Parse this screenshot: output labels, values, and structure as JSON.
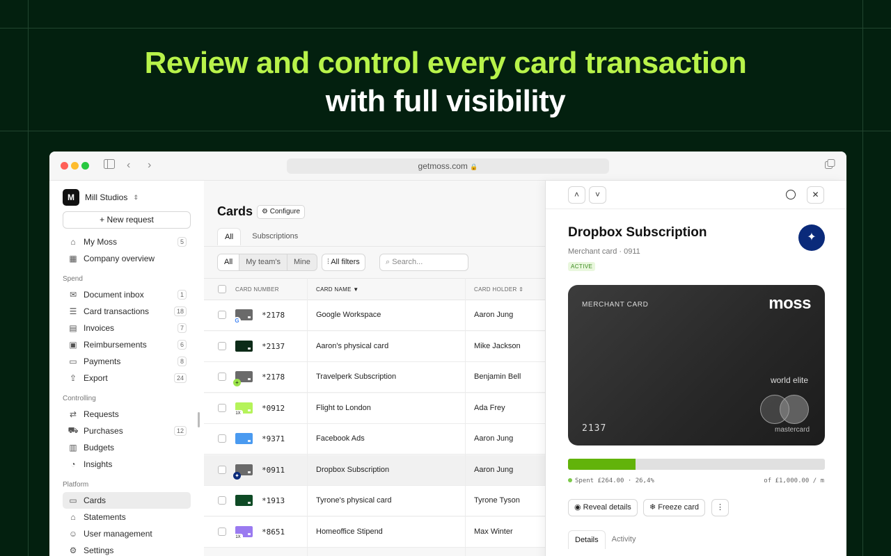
{
  "hero": {
    "line1": "Review and control every card transaction",
    "line2": "with full visibility"
  },
  "browser": {
    "url": "getmoss.com",
    "colors": {
      "close": "#ff5f57",
      "minimize": "#febc2e",
      "zoom": "#28c840"
    }
  },
  "sidebar": {
    "org_name": "Mill Studios",
    "new_request": "New request",
    "top_items": [
      {
        "label": "My Moss",
        "count": "5",
        "icon": "home-icon"
      },
      {
        "label": "Company overview",
        "count": "",
        "icon": "building-icon"
      }
    ],
    "sections": {
      "spend": "Spend",
      "controlling": "Controlling",
      "platform": "Platform"
    },
    "spend_items": [
      {
        "label": "Document inbox",
        "count": "1",
        "icon": "inbox-icon"
      },
      {
        "label": "Card transactions",
        "count": "18",
        "icon": "card-transactions-icon"
      },
      {
        "label": "Invoices",
        "count": "7",
        "icon": "invoice-icon"
      },
      {
        "label": "Reimbursements",
        "count": "6",
        "icon": "wallet-icon"
      },
      {
        "label": "Payments",
        "count": "8",
        "icon": "payments-icon"
      },
      {
        "label": "Export",
        "count": "24",
        "icon": "export-icon"
      }
    ],
    "controlling_items": [
      {
        "label": "Requests",
        "count": "",
        "icon": "requests-icon"
      },
      {
        "label": "Purchases",
        "count": "12",
        "icon": "cart-icon"
      },
      {
        "label": "Budgets",
        "count": "",
        "icon": "budgets-icon"
      },
      {
        "label": "Insights",
        "count": "",
        "icon": "pie-chart-icon"
      }
    ],
    "platform_items": [
      {
        "label": "Cards",
        "count": "",
        "icon": "cards-icon"
      },
      {
        "label": "Statements",
        "count": "",
        "icon": "bank-icon"
      },
      {
        "label": "User management",
        "count": "",
        "icon": "users-icon"
      },
      {
        "label": "Settings",
        "count": "",
        "icon": "gear-icon"
      }
    ]
  },
  "main": {
    "title": "Cards",
    "configure": "Configure",
    "tabs": [
      "All",
      "Subscriptions"
    ],
    "segments": [
      "All",
      "My team's",
      "Mine"
    ],
    "all_filters": "All filters",
    "search_placeholder": "Search...",
    "columns": {
      "card_number": "CARD NUMBER",
      "card_name": "CARD NAME",
      "card_holder": "CARD HOLDER"
    },
    "rows": [
      {
        "number": "*2178",
        "name": "Google Workspace",
        "holder": "Aaron Jung",
        "color": "#6a6a6a",
        "badge": "G"
      },
      {
        "number": "*2137",
        "name": "Aaron's physical card",
        "holder": "Mike Jackson",
        "color": "#0c2b18",
        "badge": ""
      },
      {
        "number": "*2178",
        "name": "Travelperk Subscription",
        "holder": "Benjamin Bell",
        "color": "#6a6a6a",
        "badge": "+"
      },
      {
        "number": "*0912",
        "name": "Flight to London",
        "holder": "Ada Frey",
        "color": "#b5f35a",
        "badge": "1X"
      },
      {
        "number": "*9371",
        "name": "Facebook Ads",
        "holder": "Aaron Jung",
        "color": "#4a9af0",
        "badge": ""
      },
      {
        "number": "*0911",
        "name": "Dropbox Subscription",
        "holder": "Aaron Jung",
        "color": "#6a6a6a",
        "badge": "✦"
      },
      {
        "number": "*1913",
        "name": "Tyrone's physical card",
        "holder": "Tyrone Tyson",
        "color": "#0e4a25",
        "badge": ""
      },
      {
        "number": "*8651",
        "name": "Homeoffice Stipend",
        "holder": "Max Winter",
        "color": "#9a7af0",
        "badge": "1X"
      }
    ]
  },
  "detail": {
    "title": "Dropbox Subscription",
    "subtitle": "Merchant card · 0911",
    "status": "ACTIVE",
    "card": {
      "type": "MERCHANT CARD",
      "brand": "moss",
      "tier": "world elite",
      "number": "2137",
      "network": "mastercard"
    },
    "spent_fraction": 0.264,
    "spent_text": "Spent £264.00 · 26,4%",
    "limit_text": "of £1,000.00 / m",
    "reveal": "Reveal details",
    "freeze": "Freeze card",
    "tabs": [
      "Details",
      "Activity"
    ]
  }
}
